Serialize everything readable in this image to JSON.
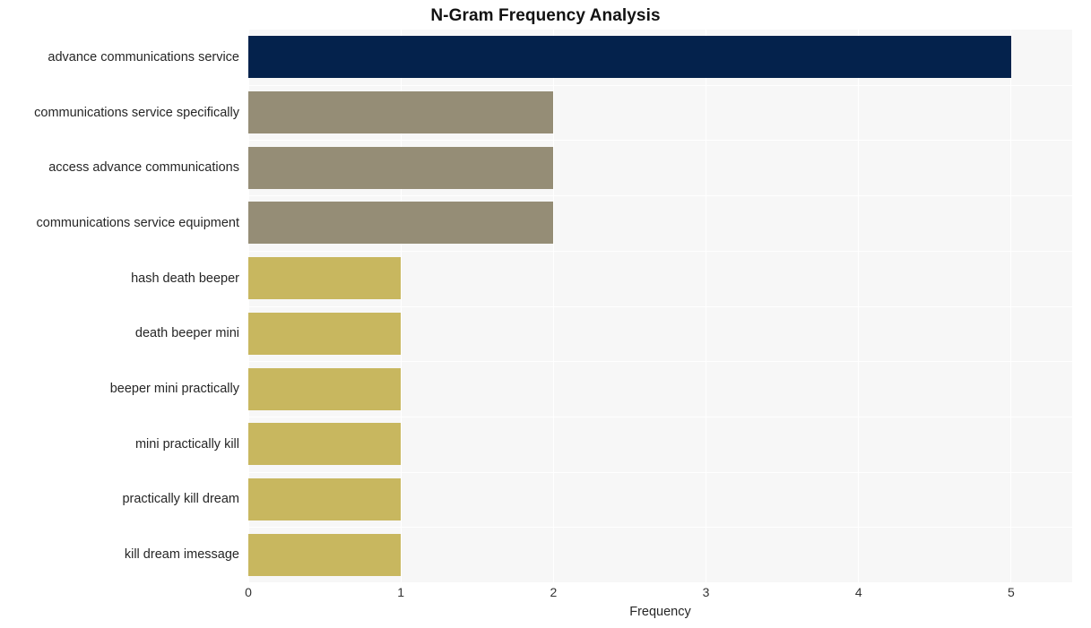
{
  "chart_data": {
    "type": "bar",
    "orientation": "horizontal",
    "title": "N-Gram Frequency Analysis",
    "xlabel": "Frequency",
    "ylabel": "",
    "xlim": [
      0,
      5.4
    ],
    "xticks": [
      "0",
      "1",
      "2",
      "3",
      "4",
      "5"
    ],
    "xtick_values": [
      0,
      1,
      2,
      3,
      4,
      5
    ],
    "grid": true,
    "grid_color": "#ffffff",
    "plot_background": "#f7f7f7",
    "legend": null,
    "categories": [
      "advance communications service",
      "communications service specifically",
      "access advance communications",
      "communications service equipment",
      "hash death beeper",
      "death beeper mini",
      "beeper mini practically",
      "mini practically kill",
      "practically kill dream",
      "kill dream imessage"
    ],
    "values": [
      5,
      2,
      2,
      2,
      1,
      1,
      1,
      1,
      1,
      1
    ],
    "bar_colors": [
      "#04224c",
      "#958d76",
      "#958d76",
      "#958d76",
      "#c8b75f",
      "#c8b75f",
      "#c8b75f",
      "#c8b75f",
      "#c8b75f",
      "#c8b75f"
    ],
    "palette": {
      "high": "#04224c",
      "medium": "#958d76",
      "low": "#c8b75f"
    },
    "text_color": "#262626",
    "title_color": "#121212"
  }
}
